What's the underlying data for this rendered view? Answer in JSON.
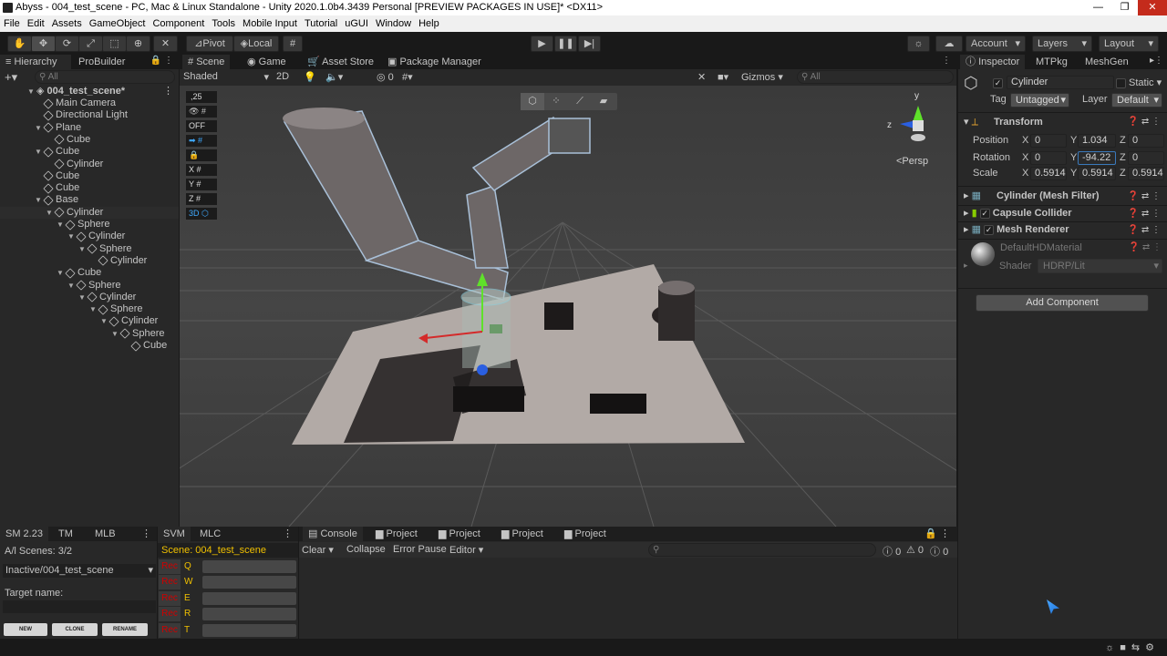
{
  "window": {
    "title": "Abyss - 004_test_scene - PC, Mac & Linux Standalone - Unity 2020.1.0b4.3439 Personal [PREVIEW PACKAGES IN USE]* <DX11>",
    "min": "—",
    "max": "❐",
    "close": "✕"
  },
  "menu": [
    "File",
    "Edit",
    "Assets",
    "GameObject",
    "Component",
    "Tools",
    "Mobile Input",
    "Tutorial",
    "uGUI",
    "Window",
    "Help"
  ],
  "toolbar": {
    "pivot": "Pivot",
    "local": "Local",
    "account": "Account",
    "layers": "Layers",
    "layout": "Layout"
  },
  "hierarchy": {
    "tabs": [
      "Hierarchy",
      "ProBuilder"
    ],
    "search_placeholder": "All",
    "scene": "004_test_scene*",
    "items": [
      {
        "label": "Main Camera",
        "depth": 1,
        "arrow": ""
      },
      {
        "label": "Directional Light",
        "depth": 1,
        "arrow": ""
      },
      {
        "label": "Plane",
        "depth": 1,
        "arrow": "▼"
      },
      {
        "label": "Cube",
        "depth": 2,
        "arrow": ""
      },
      {
        "label": "Cube",
        "depth": 1,
        "arrow": "▼"
      },
      {
        "label": "Cylinder",
        "depth": 2,
        "arrow": ""
      },
      {
        "label": "Cube",
        "depth": 1,
        "arrow": ""
      },
      {
        "label": "Cube",
        "depth": 1,
        "arrow": ""
      },
      {
        "label": "Base",
        "depth": 1,
        "arrow": "▼"
      },
      {
        "label": "Cylinder",
        "depth": 2,
        "arrow": "▼"
      },
      {
        "label": "Sphere",
        "depth": 3,
        "arrow": "▼"
      },
      {
        "label": "Cylinder",
        "depth": 4,
        "arrow": "▼"
      },
      {
        "label": "Sphere",
        "depth": 5,
        "arrow": "▼"
      },
      {
        "label": "Cylinder",
        "depth": 6,
        "arrow": ""
      },
      {
        "label": "Cube",
        "depth": 3,
        "arrow": "▼"
      },
      {
        "label": "Sphere",
        "depth": 4,
        "arrow": "▼"
      },
      {
        "label": "Cylinder",
        "depth": 5,
        "arrow": "▼"
      },
      {
        "label": "Sphere",
        "depth": 6,
        "arrow": "▼"
      },
      {
        "label": "Cylinder",
        "depth": 7,
        "arrow": "▼"
      },
      {
        "label": "Sphere",
        "depth": 8,
        "arrow": "▼"
      },
      {
        "label": "Cube",
        "depth": 9,
        "arrow": ""
      }
    ]
  },
  "scene": {
    "tabs": [
      "Scene",
      "Game",
      "Asset Store",
      "Package Manager"
    ],
    "shading": "Shaded",
    "mode2d": "2D",
    "audio_count": "0",
    "gizmos": "Gizmos",
    "search_placeholder": "All",
    "persp": "<Persp",
    "axis_y": "y",
    "axis_z": "z",
    "toolbox": [
      ",25",
      "OFF",
      "X",
      "Y",
      "Z",
      "3D"
    ]
  },
  "inspector": {
    "tabs": [
      "Inspector",
      "MTPkg",
      "MeshGen"
    ],
    "object_name": "Cylinder",
    "static": "Static",
    "tag_label": "Tag",
    "tag": "Untagged",
    "layer_label": "Layer",
    "layer": "Default",
    "transform": {
      "title": "Transform",
      "position_label": "Position",
      "rotation_label": "Rotation",
      "scale_label": "Scale",
      "position": {
        "x": "0",
        "y": "1.034",
        "z": "0"
      },
      "rotation": {
        "x": "0",
        "y": "-94.22",
        "z": "0"
      },
      "scale": {
        "x": "0.5914",
        "y": "0.5914",
        "z": "0.5914"
      }
    },
    "components": [
      "Cylinder (Mesh Filter)",
      "Capsule Collider",
      "Mesh Renderer"
    ],
    "material": "DefaultHDMaterial",
    "shader_label": "Shader",
    "shader": "HDRP/Lit",
    "add_component": "Add Component"
  },
  "sm": {
    "tabs": [
      "SM 2.23",
      "TM",
      "MLB"
    ],
    "all_scenes": "A/l Scenes: 3/2",
    "scene_select": "Inactive/004_test_scene",
    "target": "Target name:",
    "buttons": [
      "NEW",
      "CLONE",
      "RENAME"
    ]
  },
  "svm": {
    "tabs": [
      "SVM",
      "MLC"
    ],
    "scene": "Scene: 004_test_scene",
    "rec": "Rec",
    "keys": [
      "Q",
      "W",
      "E",
      "R",
      "T"
    ]
  },
  "console": {
    "tabs": [
      "Console",
      "Project",
      "Project",
      "Project",
      "Project"
    ],
    "clear": "Clear",
    "collapse": "Collapse",
    "error_pause": "Error Pause",
    "editor": "Editor",
    "counts": [
      "0",
      "0",
      "0"
    ]
  },
  "axis_labels": {
    "x": "X",
    "y": "Y",
    "z": "Z"
  }
}
